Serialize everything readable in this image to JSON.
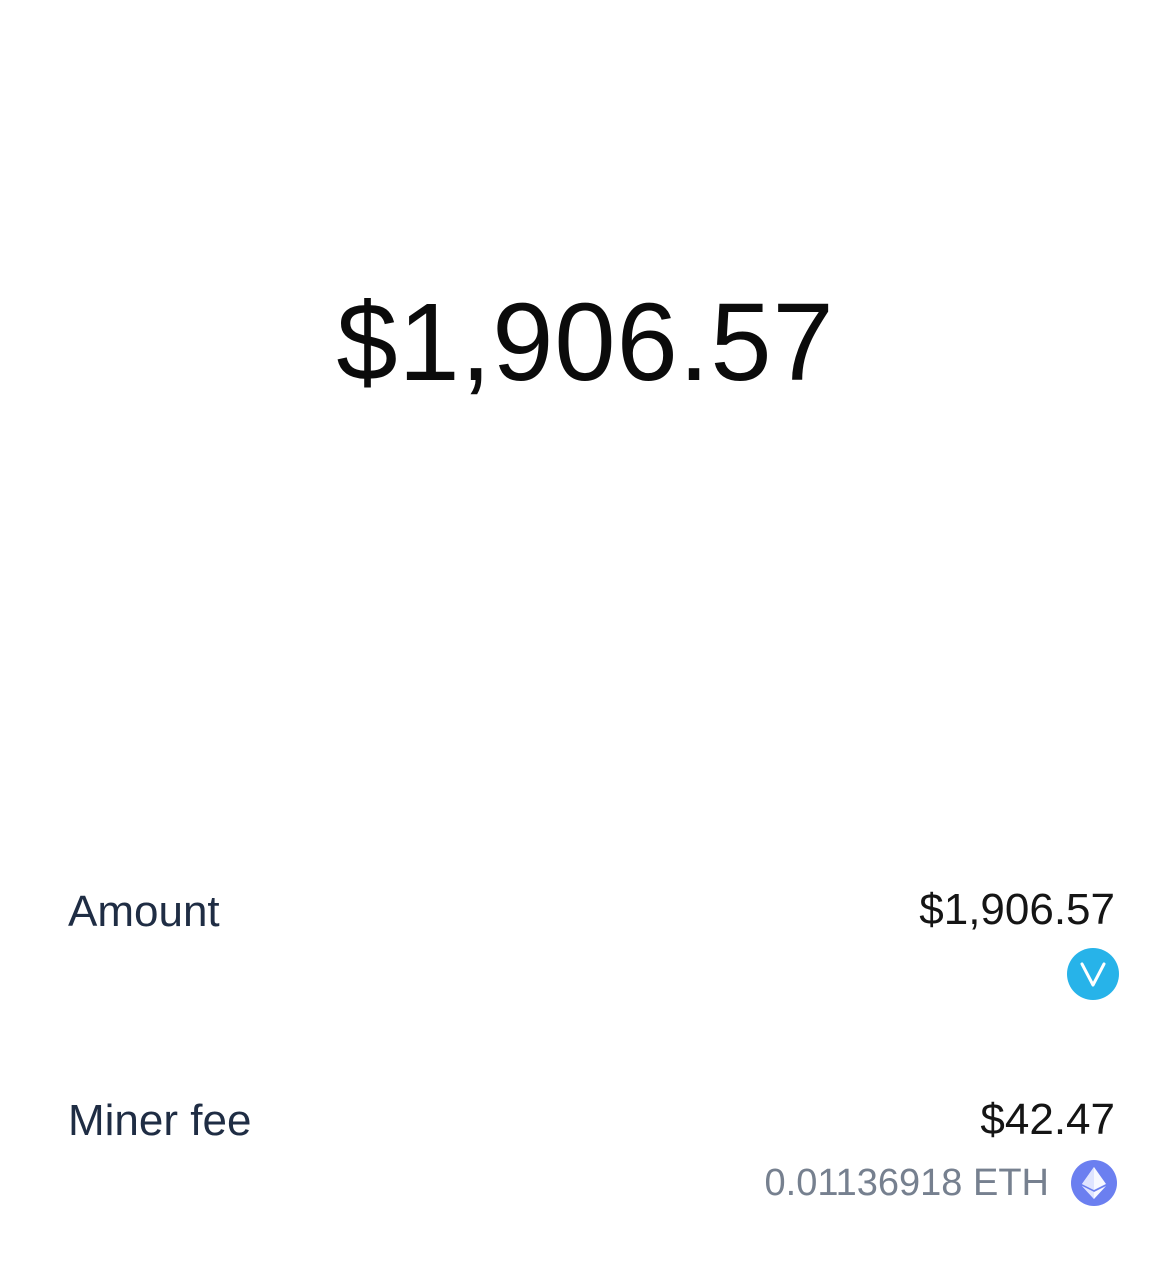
{
  "header": {
    "total_amount": "$1,906.57"
  },
  "details": {
    "amount": {
      "label": "Amount",
      "value": "$1,906.57",
      "token_icon": "vechain-icon"
    },
    "miner_fee": {
      "label": "Miner fee",
      "value": "$42.47",
      "crypto_value": "0.01136918 ETH",
      "token_icon": "ethereum-icon"
    }
  },
  "colors": {
    "vechain": "#27b3e9",
    "ethereum": "#6b7ff0",
    "label_text": "#1f2d44",
    "secondary_text": "#76808f"
  }
}
